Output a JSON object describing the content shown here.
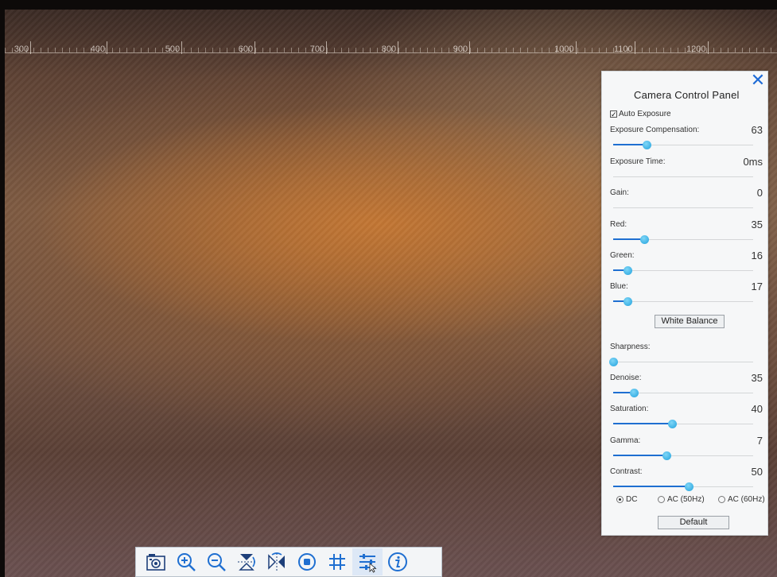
{
  "ruler": {
    "labels": [
      "300",
      "400",
      "500",
      "600",
      "700",
      "800",
      "900",
      "1000",
      "1100",
      "1200"
    ]
  },
  "panel": {
    "title": "Camera Control Panel",
    "auto_exposure_label": "Auto Exposure",
    "auto_exposure_checked": true,
    "controls": [
      {
        "label": "Exposure Compensation:",
        "value": "63",
        "fraction": 0.24
      },
      {
        "label": "Exposure Time:",
        "value": "0ms",
        "fraction": 0.0
      },
      {
        "label": "Gain:",
        "value": "0",
        "fraction": 0.0
      },
      {
        "label": "Red:",
        "value": "35",
        "fraction": 0.22
      },
      {
        "label": "Green:",
        "value": "16",
        "fraction": 0.1
      },
      {
        "label": "Blue:",
        "value": "17",
        "fraction": 0.1
      },
      {
        "label": "Sharpness:",
        "value": "",
        "fraction": 0.0
      },
      {
        "label": "Denoise:",
        "value": "35",
        "fraction": 0.15
      },
      {
        "label": "Saturation:",
        "value": "40",
        "fraction": 0.42
      },
      {
        "label": "Gamma:",
        "value": "7",
        "fraction": 0.38
      },
      {
        "label": "Contrast:",
        "value": "50",
        "fraction": 0.54
      }
    ],
    "white_balance_label": "White Balance",
    "radios": [
      {
        "label": "DC",
        "selected": true
      },
      {
        "label": "AC (50Hz)",
        "selected": false
      },
      {
        "label": "AC (60Hz)",
        "selected": false
      }
    ],
    "default_label": "Default",
    "close_glyph": "✕"
  },
  "toolbar": {
    "tools": [
      {
        "name": "camera-capture-icon"
      },
      {
        "name": "zoom-in-icon"
      },
      {
        "name": "zoom-out-icon"
      },
      {
        "name": "flip-vertical-icon"
      },
      {
        "name": "flip-horizontal-icon"
      },
      {
        "name": "record-icon"
      },
      {
        "name": "grid-icon"
      },
      {
        "name": "settings-sliders-icon"
      },
      {
        "name": "info-icon"
      }
    ]
  },
  "colors": {
    "accent": "#1f6fd1",
    "knob": "#22a2dd"
  }
}
